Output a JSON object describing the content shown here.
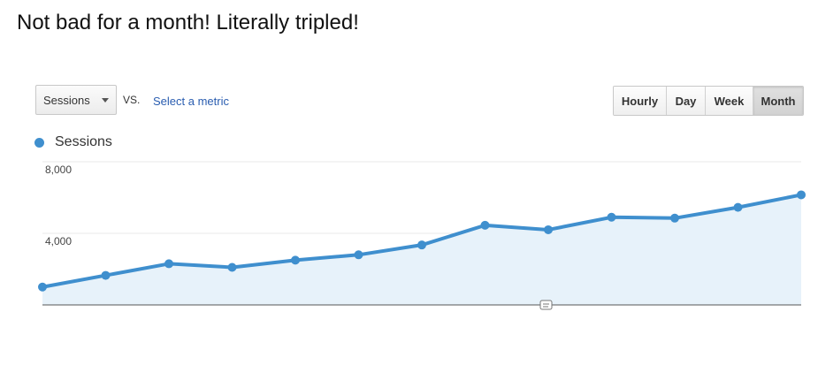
{
  "post": {
    "caption": "Not bad for a month! Literally tripled!"
  },
  "toolbar": {
    "metric_selected": "Sessions",
    "vs_label": "VS.",
    "select_metric_link": "Select a metric",
    "granularity": [
      {
        "label": "Hourly",
        "active": false
      },
      {
        "label": "Day",
        "active": false
      },
      {
        "label": "Week",
        "active": false
      },
      {
        "label": "Month",
        "active": true
      }
    ]
  },
  "colors": {
    "series": "#3f8fce",
    "area_fill": "#e7f2fa",
    "grid": "#e8e8e8",
    "baseline": "#555555"
  },
  "chart_data": {
    "type": "line",
    "series": [
      {
        "name": "Sessions",
        "values": [
          1000,
          1650,
          2300,
          2100,
          2500,
          2800,
          3350,
          4450,
          4200,
          4900,
          4850,
          5450,
          6150
        ]
      }
    ],
    "y_ticks": [
      "8,000",
      "4,000"
    ],
    "ylim": [
      0,
      8000
    ],
    "legend": "top-left",
    "grid": true
  }
}
